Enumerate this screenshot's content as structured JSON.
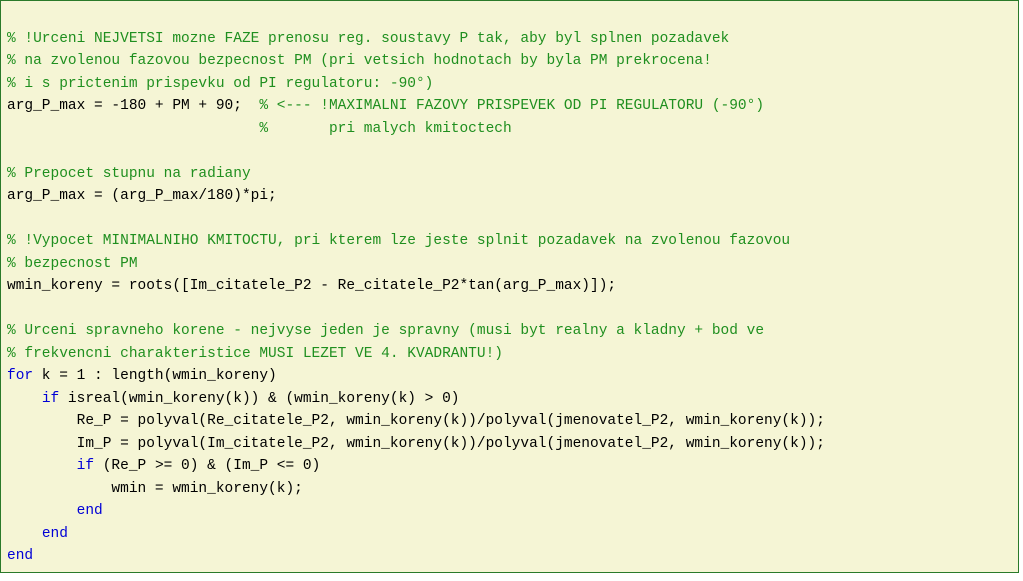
{
  "l1": "% !Urceni NEJVETSI mozne FAZE prenosu reg. soustavy P tak, aby byl splnen pozadavek",
  "l2": "% na zvolenou fazovou bezpecnost PM (pri vetsich hodnotach by byla PM prekrocena!",
  "l3": "% i s prictenim prispevku od PI regulatoru: -90°)",
  "l4a": "arg_P_max = -180 + PM + 90;  ",
  "l4b": "% <--- !MAXIMALNI FAZOVY PRISPEVEK OD PI REGULATORU (-90°)",
  "l5": "                             %       pri malych kmitoctech",
  "l6": " ",
  "l7": "% Prepocet stupnu na radiany",
  "l8": "arg_P_max = (arg_P_max/180)*pi;",
  "l9": " ",
  "l10": "% !Vypocet MINIMALNIHO KMITOCTU, pri kterem lze jeste splnit pozadavek na zvolenou fazovou",
  "l11": "% bezpecnost PM",
  "l12": "wmin_koreny = roots([Im_citatele_P2 - Re_citatele_P2*tan(arg_P_max)]);",
  "l13": " ",
  "l14": "% Urceni spravneho korene - nejvyse jeden je spravny (musi byt realny a kladny + bod ve",
  "l15": "% frekvencni charakteristice MUSI LEZET VE 4. KVADRANTU!)",
  "l16a": "for",
  "l16b": " k = 1 : length(wmin_koreny)",
  "l17a": "    ",
  "l17b": "if",
  "l17c": " isreal(wmin_koreny(k)) & (wmin_koreny(k) > 0)",
  "l18": "        Re_P = polyval(Re_citatele_P2, wmin_koreny(k))/polyval(jmenovatel_P2, wmin_koreny(k));",
  "l19": "        Im_P = polyval(Im_citatele_P2, wmin_koreny(k))/polyval(jmenovatel_P2, wmin_koreny(k));",
  "l20a": "        ",
  "l20b": "if",
  "l20c": " (Re_P >= 0) & (Im_P <= 0)",
  "l21": "            wmin = wmin_koreny(k);",
  "l22a": "        ",
  "l22b": "end",
  "l23a": "    ",
  "l23b": "end",
  "l24": "end"
}
